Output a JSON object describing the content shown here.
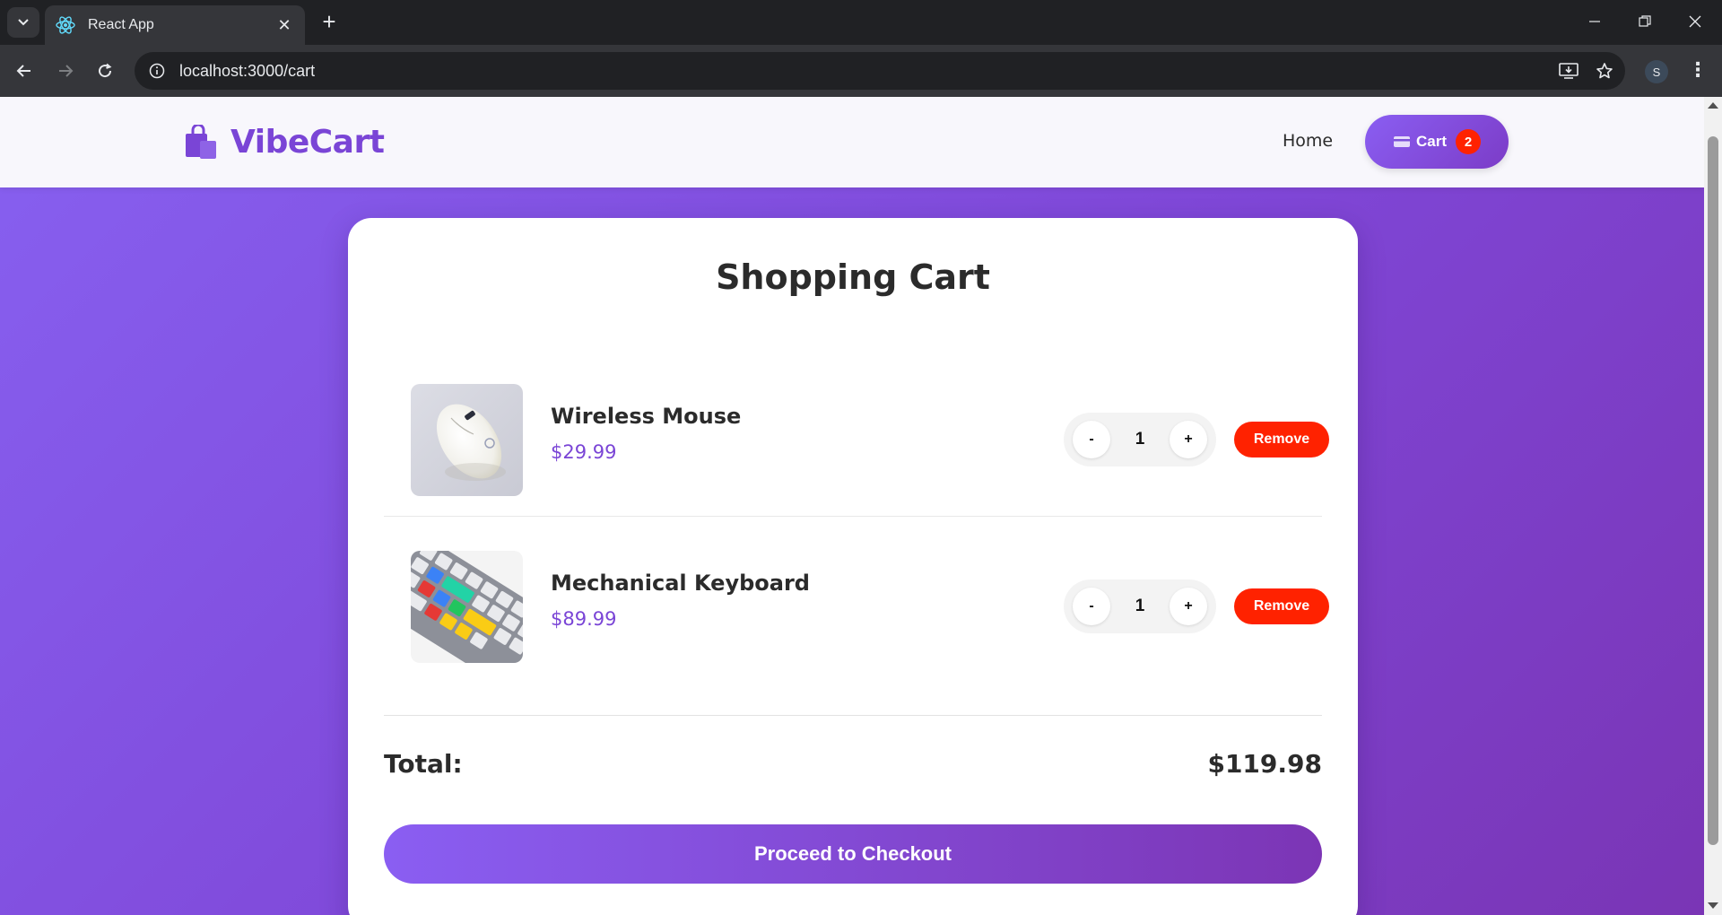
{
  "browser": {
    "tab_title": "React App",
    "url": "localhost:3000/cart",
    "profile_initial": "S",
    "icons": {
      "tab_menu": "chevron-down-icon",
      "favicon": "react-logo-icon",
      "tab_close": "close-icon",
      "new_tab": "plus-icon",
      "back": "arrow-left-icon",
      "forward": "arrow-right-icon",
      "reload": "reload-icon",
      "site_info": "info-icon",
      "install": "install-app-icon",
      "bookmark": "star-icon",
      "menu": "more-vert-icon"
    }
  },
  "site": {
    "brand": "VibeCart",
    "brand_icon": "shopping-bag-icon",
    "nav": {
      "home_label": "Home",
      "cart_label": "Cart",
      "cart_icon": "card-icon",
      "cart_count": "2"
    }
  },
  "cart": {
    "title": "Shopping Cart",
    "items": [
      {
        "name": "Wireless Mouse",
        "price": "$29.99",
        "quantity": "1",
        "minus_label": "-",
        "plus_label": "+",
        "remove_label": "Remove",
        "image_icon": "mouse-product-image"
      },
      {
        "name": "Mechanical Keyboard",
        "price": "$89.99",
        "quantity": "1",
        "minus_label": "-",
        "plus_label": "+",
        "remove_label": "Remove",
        "image_icon": "keyboard-product-image"
      }
    ],
    "total_label": "Total:",
    "total_value": "$119.98",
    "checkout_label": "Proceed to Checkout"
  },
  "colors": {
    "accent": "#7a45d6",
    "gradient_start": "#8760f0",
    "gradient_end": "#7a35b5",
    "danger": "#ff2200",
    "text": "#2b2b2b"
  }
}
